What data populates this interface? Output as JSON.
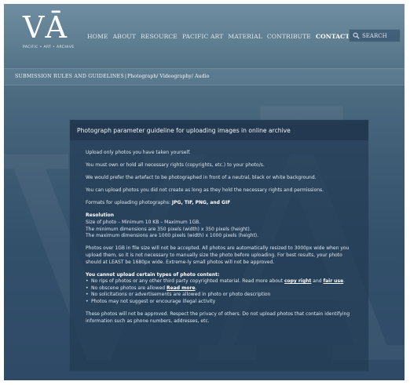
{
  "logo": {
    "mark": "VĀ",
    "subtitle": "PACIFIC • ART • ARCHIVE"
  },
  "nav": {
    "items": [
      {
        "label": "HOME",
        "active": false
      },
      {
        "label": "ABOUT",
        "active": false
      },
      {
        "label": "RESOURCE",
        "active": false
      },
      {
        "label": "PACIFIC ART",
        "active": false
      },
      {
        "label": "MATERIAL",
        "active": false
      },
      {
        "label": "CONTRIBUTE",
        "active": false
      },
      {
        "label": "CONTACT",
        "active": true
      }
    ],
    "search": {
      "placeholder": "SEARCH",
      "icon": "search-icon"
    }
  },
  "subnav": {
    "title": "SUBMISSION RULES AND GUIDELINES",
    "separator": "|",
    "links": [
      "Photograph",
      "Videography",
      "Audio"
    ],
    "link_separator": "/ "
  },
  "panel": {
    "title": "Photograph parameter guideline for uploading images in online archive",
    "para1": "Upload only photos you have taken yourself.",
    "para2": "You must own or hold all necessary rights (copyrights, etc.) to your photo/s.",
    "para3": "We would prefer the artefact to be photographed in front of a neutral, black or white background.",
    "para4": "You can upload photos you did not create as long as they hold the necessary rights and permissions.",
    "formats_prefix": "Formats for uploading photographs: ",
    "formats_value": "JPG, TIF, PNG, and GIF",
    "resolution_heading": "Resolution",
    "resolution_lines": [
      "Size of photo – Minimum 10 KB – Maximum 1GB.",
      "The minimum dimensions are 350 pixels (width) x 350 pixels (height).",
      "The maximum dimensions are 1000 pixels (width) x 1000 pixels (height)."
    ],
    "para5": "Photos over 1GB in file size will not be accepted.  All photos are automatically resized to 3000px wide when you upload them, so it is not necessary to manually size the photo before uploading.  For best results, your photo should at LEAST be 1680px wide.  Extreme-ly small photos will not be approved.",
    "restrictions_heading": "You cannot upload certain types of photo content:",
    "restriction1_prefix": "No rips of photos or any other third party copyrighted material. Read more about ",
    "restriction1_link1": "copy right",
    "restriction1_and": " and ",
    "restriction1_link2": "fair use",
    "restriction1_suffix": ".",
    "restriction2_prefix": "No obscene photos are allowed ",
    "restriction2_link": "Read more",
    "restriction2_suffix": ".",
    "restriction3": "No solicitations or advertisements are allowed in photo or photo description",
    "restriction4": "Photos may not suggest or encourage illegal activity",
    "para6": "These photos will not be approved. Respect the privacy of others.  Do not upload photos that contain identifying information such as phone numbers, addresses, etc."
  }
}
